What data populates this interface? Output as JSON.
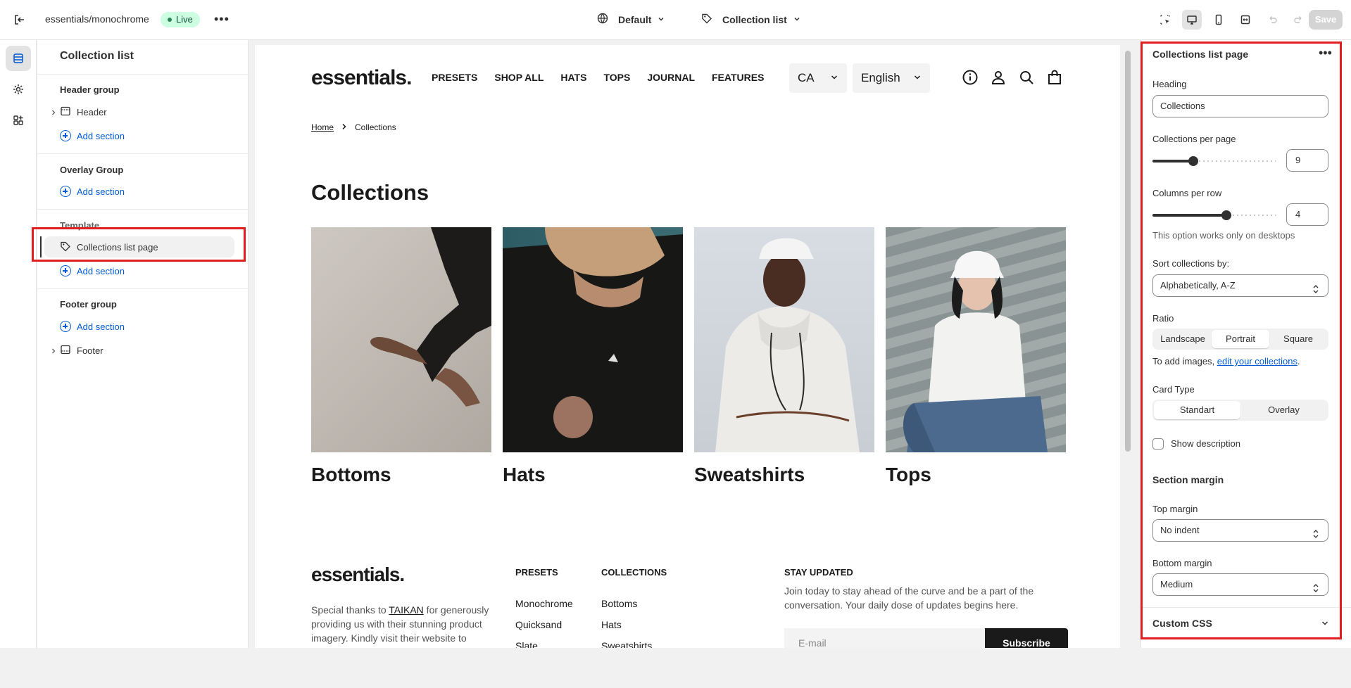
{
  "topbar": {
    "store_name": "essentials/monochrome",
    "status": "Live",
    "theme_select": "Default",
    "template_select": "Collection list",
    "save_label": "Save"
  },
  "sidebar": {
    "title": "Collection list",
    "header_group": {
      "title": "Header group",
      "item": "Header",
      "add": "Add section"
    },
    "overlay_group": {
      "title": "Overlay Group",
      "add": "Add section"
    },
    "template": {
      "title": "Template",
      "item": "Collections list page",
      "add": "Add section"
    },
    "footer_group": {
      "title": "Footer group",
      "add": "Add section",
      "item": "Footer"
    }
  },
  "preview": {
    "logo": "essentials.",
    "nav": [
      "PRESETS",
      "SHOP ALL",
      "HATS",
      "TOPS",
      "JOURNAL",
      "FEATURES"
    ],
    "country": "CA",
    "language": "English",
    "breadcrumb": {
      "home": "Home",
      "current": "Collections"
    },
    "heading": "Collections",
    "collections": [
      {
        "name": "Bottoms"
      },
      {
        "name": "Hats"
      },
      {
        "name": "Sweatshirts"
      },
      {
        "name": "Tops"
      }
    ],
    "footer": {
      "logo": "essentials.",
      "thanks_pre": "Special thanks to ",
      "thanks_link": "TAIKAN",
      "thanks_post": " for generously",
      "thanks_line2": "providing us with their stunning product",
      "thanks_line3": "imagery. Kindly visit their website to",
      "presets_title": "PRESETS",
      "presets_links": [
        "Monochrome",
        "Quicksand",
        "Slate"
      ],
      "collections_title": "COLLECTIONS",
      "collections_links": [
        "Bottoms",
        "Hats",
        "Sweatshirts"
      ],
      "stay_title": "STAY UPDATED",
      "stay_line1": "Join today to stay ahead of the curve and be a part of the",
      "stay_line2": "conversation. Your daily dose of updates begins here.",
      "email_placeholder": "E-mail",
      "subscribe": "Subscribe"
    }
  },
  "panel": {
    "title": "Collections list page",
    "heading_label": "Heading",
    "heading_value": "Collections",
    "per_page_label": "Collections per page",
    "per_page_value": "9",
    "per_page_level": 0.33,
    "columns_label": "Columns per row",
    "columns_value": "4",
    "columns_level": 0.6,
    "columns_help": "This option works only on desktops",
    "sort_label": "Sort collections by:",
    "sort_value": "Alphabetically, A-Z",
    "ratio_label": "Ratio",
    "ratio_options": [
      "Landscape",
      "Portrait",
      "Square"
    ],
    "ratio_selected": "Portrait",
    "ratio_help_pre": "To add images, ",
    "ratio_help_link": "edit your collections",
    "ratio_help_post": ".",
    "card_type_label": "Card Type",
    "card_type_options": [
      "Standart",
      "Overlay"
    ],
    "card_type_selected": "Standart",
    "show_description": "Show description",
    "section_margin": "Section margin",
    "top_margin_label": "Top margin",
    "top_margin_value": "No indent",
    "bottom_margin_label": "Bottom margin",
    "bottom_margin_value": "Medium",
    "custom_css": "Custom CSS"
  },
  "colors": {
    "accent": "#005bd3",
    "highlight": "#e01e1e",
    "live_bg": "#cdfee1"
  }
}
